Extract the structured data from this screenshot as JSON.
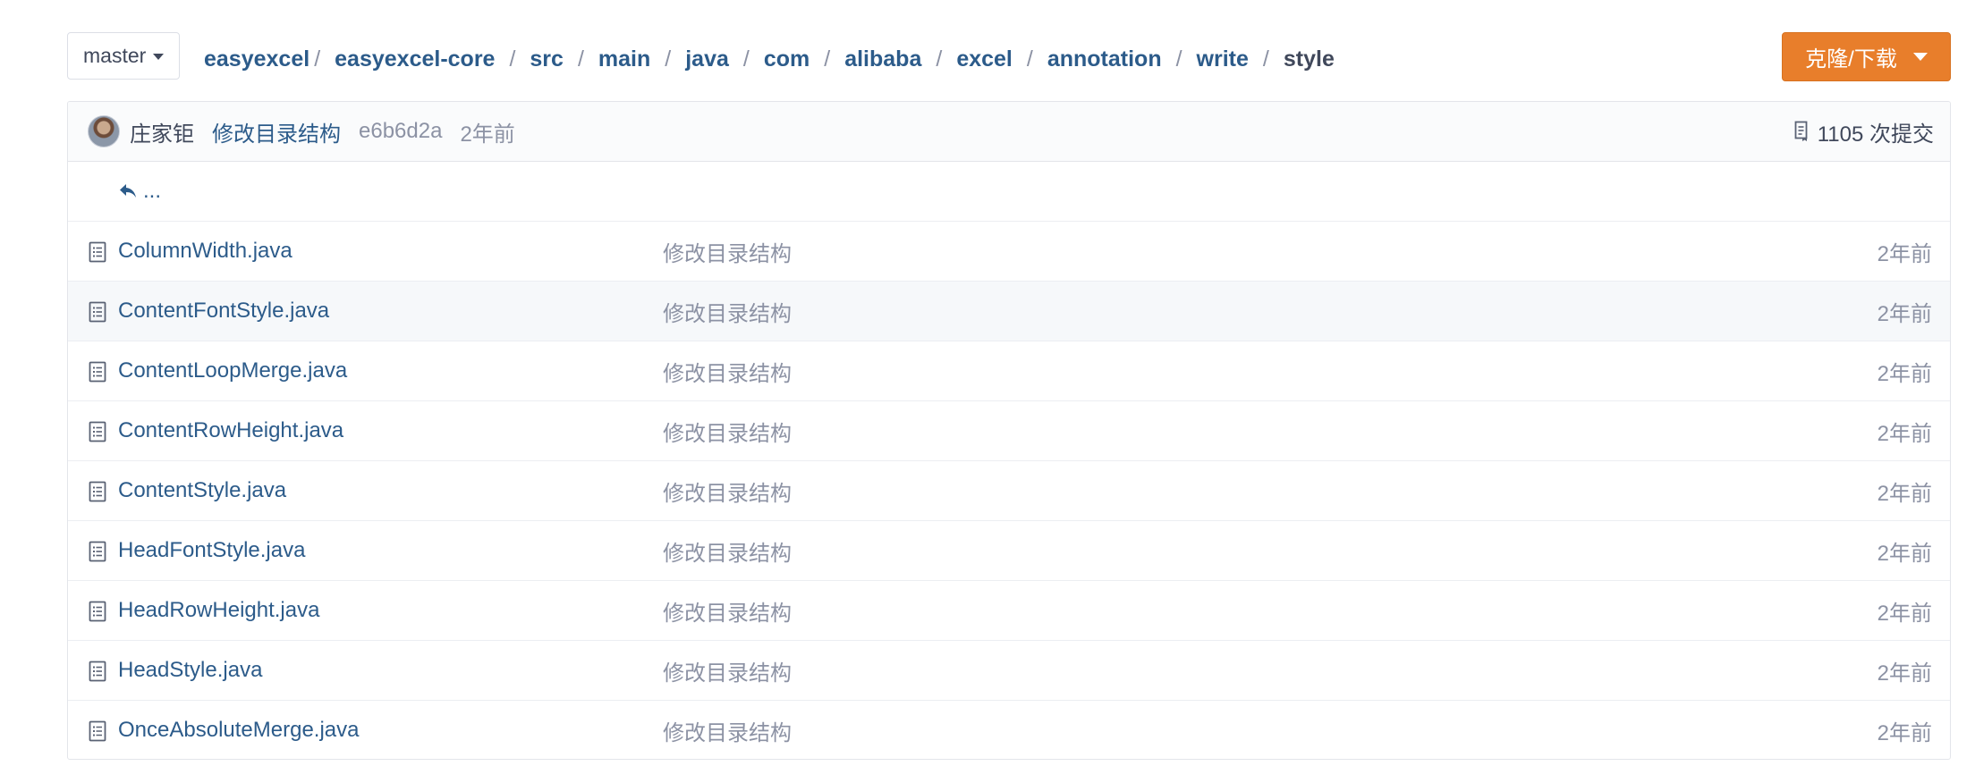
{
  "branch": {
    "label": "master"
  },
  "breadcrumb": [
    {
      "label": "easyexcel"
    },
    {
      "label": "easyexcel-core"
    },
    {
      "label": "src"
    },
    {
      "label": "main"
    },
    {
      "label": "java"
    },
    {
      "label": "com"
    },
    {
      "label": "alibaba"
    },
    {
      "label": "excel"
    },
    {
      "label": "annotation"
    },
    {
      "label": "write"
    },
    {
      "label": "style"
    }
  ],
  "separator": "/",
  "clone_button": {
    "label": "克隆/下载"
  },
  "last_commit": {
    "author": "庄家钜",
    "message": "修改目录结构",
    "sha": "e6b6d2a",
    "time": "2年前",
    "commit_count": "1105 次提交"
  },
  "parent_dir": {
    "label": "..."
  },
  "files": [
    {
      "name": "ColumnWidth.java",
      "message": "修改目录结构",
      "time": "2年前"
    },
    {
      "name": "ContentFontStyle.java",
      "message": "修改目录结构",
      "time": "2年前"
    },
    {
      "name": "ContentLoopMerge.java",
      "message": "修改目录结构",
      "time": "2年前"
    },
    {
      "name": "ContentRowHeight.java",
      "message": "修改目录结构",
      "time": "2年前"
    },
    {
      "name": "ContentStyle.java",
      "message": "修改目录结构",
      "time": "2年前"
    },
    {
      "name": "HeadFontStyle.java",
      "message": "修改目录结构",
      "time": "2年前"
    },
    {
      "name": "HeadRowHeight.java",
      "message": "修改目录结构",
      "time": "2年前"
    },
    {
      "name": "HeadStyle.java",
      "message": "修改目录结构",
      "time": "2年前"
    },
    {
      "name": "OnceAbsoluteMerge.java",
      "message": "修改目录结构",
      "time": "2年前"
    }
  ],
  "colors": {
    "accent": "#e87e2b",
    "link": "#2c5b8a",
    "muted": "#8c92a4",
    "hover_row": "#f6f8fa"
  },
  "icons": {
    "branch_caret": "caret-down-icon",
    "clone_caret": "caret-down-icon",
    "commit_count": "commit-log-icon",
    "parent_dir": "back-arrow-icon",
    "file": "file-text-icon"
  }
}
